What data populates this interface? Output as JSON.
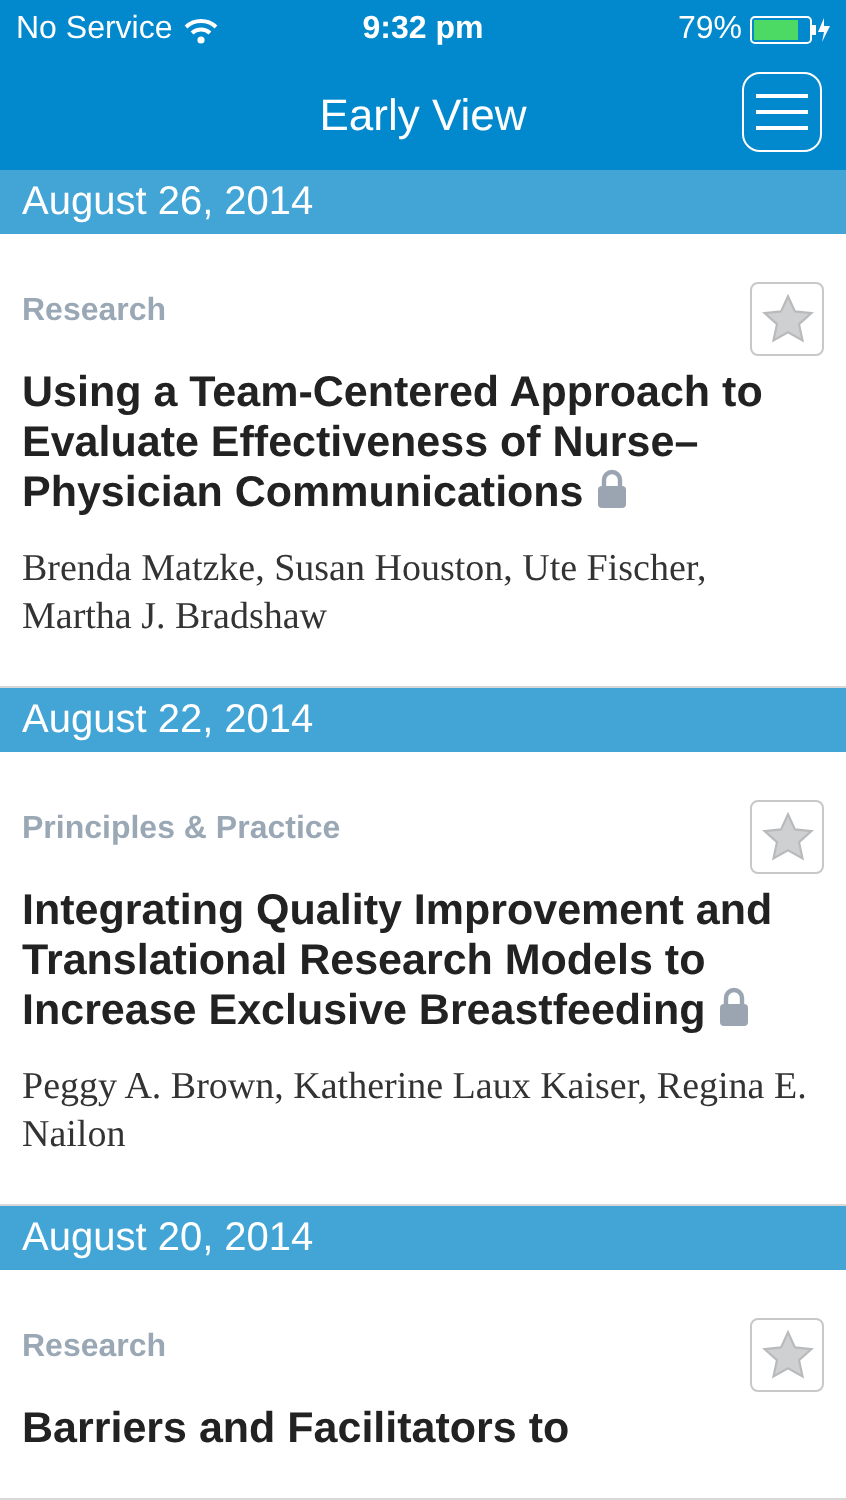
{
  "status_bar": {
    "carrier": "No Service",
    "time": "9:32 pm",
    "battery": "79%"
  },
  "nav": {
    "title": "Early View"
  },
  "sections": [
    {
      "date": "August 26, 2014",
      "articles": [
        {
          "category": "Research",
          "title": "Using a Team-Centered Approach to Evaluate Effectiveness of Nurse–Physician Communications",
          "locked": true,
          "starred": false,
          "authors": "Brenda Matzke, Susan Houston, Ute Fischer, Martha J. Bradshaw"
        }
      ]
    },
    {
      "date": "August 22, 2014",
      "articles": [
        {
          "category": "Principles & Practice",
          "title": "Integrating Quality Improvement and Translational Research Models to Increase Exclusive Breastfeeding",
          "locked": true,
          "starred": false,
          "authors": "Peggy A. Brown, Katherine Laux Kaiser, Regina E. Nailon"
        }
      ]
    },
    {
      "date": "August 20, 2014",
      "articles": [
        {
          "category": "Research",
          "title": "Barriers and Facilitators to",
          "locked": false,
          "starred": false
        }
      ]
    }
  ]
}
